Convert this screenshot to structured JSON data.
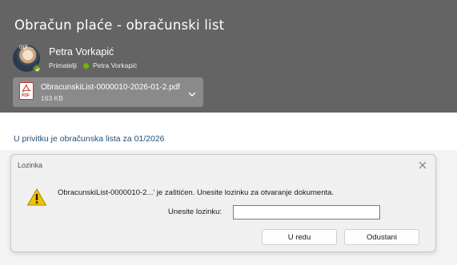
{
  "email": {
    "subject": "Obračun plaće - obračunski list",
    "avatar_label": "ogi...",
    "sender_name": "Petra Vorkapić",
    "recipients_label": "Primatelji",
    "recipient_name": "Petra Vorkapić",
    "attachment": {
      "file_name": "ObracunskiList-0000010-2026-01-2.pdf",
      "file_size": "163 KB",
      "icon_tag": "PDF"
    },
    "body_text": "U privitku je obračunska lista za 01/2026"
  },
  "dialog": {
    "title": "Lozinka",
    "message": "ObracunskiList-0000010-2...' je zaštićen. Unesite lozinku za otvaranje dokumenta.",
    "password_label": "Unesite lozinku:",
    "password_value": "",
    "ok_label": "U redu",
    "cancel_label": "Odustani"
  },
  "colors": {
    "header_bg": "#646464",
    "presence_green": "#6bb700",
    "body_link_blue": "#1f4e79",
    "pdf_red": "#c93a2c",
    "warning_yellow": "#f2c200"
  },
  "icons": {
    "presence": "check-circle-icon",
    "attachment": "pdf-icon",
    "expand": "chevron-down-icon",
    "close": "close-icon",
    "warning": "warning-icon"
  }
}
